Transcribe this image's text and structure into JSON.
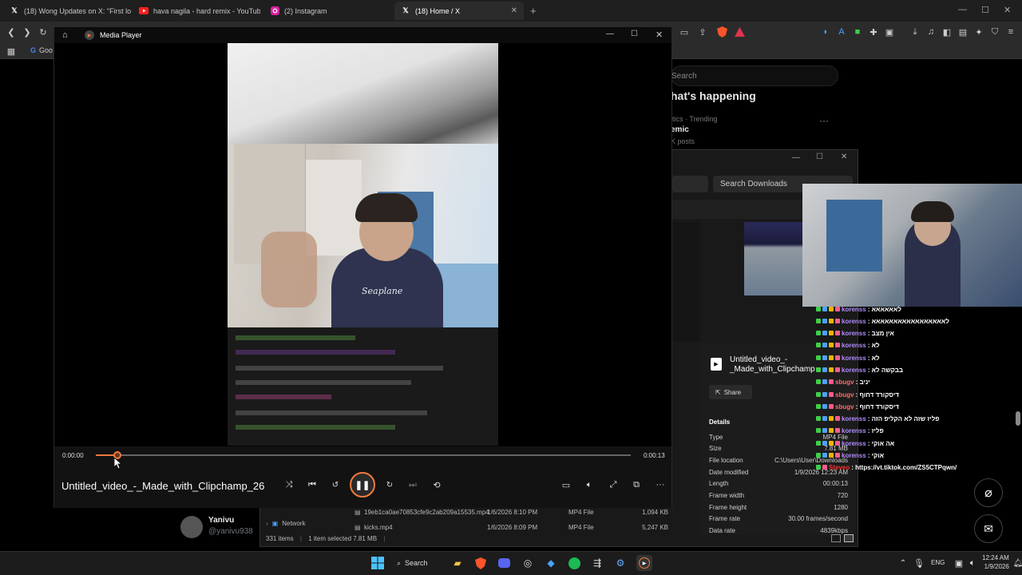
{
  "browser": {
    "tabs": [
      {
        "label": "(18) Wong Updates on X: \"First look",
        "icon": "x-logo"
      },
      {
        "label": "hava nagila - hard remix - YouTube",
        "icon": "youtube-logo"
      },
      {
        "label": "(2) Instagram",
        "icon": "instagram-logo"
      },
      {
        "label": "(18) Home / X",
        "icon": "x-logo"
      }
    ],
    "bookmark_label": "Goo"
  },
  "x_page": {
    "search_placeholder": "Search",
    "heading": "hat's happening",
    "trend_category": "itics · Trending",
    "trend_title": "emic",
    "trend_posts": "K posts"
  },
  "media_player": {
    "app_title": "Media Player",
    "current_time": "0:00:00",
    "total_time": "0:00:13",
    "progress": 0.04,
    "file_title": "Untitled_video_-_Made_with_Clipchamp_26"
  },
  "explorer": {
    "search_placeholder": "Search Downloads",
    "selected_file_name_line1": "Untitled_video_-",
    "selected_file_name_line2": "_Made_with_Clipchamp",
    "share_label": "Share",
    "details_heading": "Details",
    "details": [
      {
        "key": "Type",
        "value": "MP4 File"
      },
      {
        "key": "Size",
        "value": "7.81 MB"
      },
      {
        "key": "File location",
        "value": "C:\\Users\\User\\Downloads"
      },
      {
        "key": "Date modified",
        "value": "1/9/2026 12:23 AM"
      },
      {
        "key": "Length",
        "value": "00:00:13"
      },
      {
        "key": "Frame width",
        "value": "720"
      },
      {
        "key": "Frame height",
        "value": "1280"
      },
      {
        "key": "Frame rate",
        "value": "30.00 frames/second"
      },
      {
        "key": "Data rate",
        "value": "4839kbps"
      }
    ],
    "files": [
      {
        "name": "19eb1ca0ae70853cfe9c2ab209a15535.mp4",
        "date": "1/6/2026 8:10 PM",
        "type": "MP4 File",
        "size": "1,094 KB"
      },
      {
        "name": "kicks.mp4",
        "date": "1/6/2026 8:09 PM",
        "type": "MP4 File",
        "size": "5,247 KB"
      }
    ],
    "nav_network": "Network",
    "status_items": "331 items",
    "status_selected": "1 item selected  7.81 MB"
  },
  "chat": [
    {
      "user": "korenss",
      "msg": ": לאאאאאא"
    },
    {
      "user": "korenss",
      "msg": ": לאאאאאאאאאאאאאאאאא"
    },
    {
      "user": "korenss",
      "msg": ": אין מצב"
    },
    {
      "user": "korenss",
      "msg": ": לא"
    },
    {
      "user": "korenss",
      "msg": ": לא"
    },
    {
      "user": "korenss",
      "msg": ": בבקשה לא"
    },
    {
      "user": "sbugv",
      "msg": ": יניב"
    },
    {
      "user": "sbugv",
      "msg": ": דיסקורד דחוף"
    },
    {
      "user": "sbugv",
      "msg": ": דיסקורד דחוף"
    },
    {
      "user": "korenss",
      "msg": ": פליז שזה לא הקליפ הזה"
    },
    {
      "user": "korenss",
      "msg": ": פליז"
    },
    {
      "user": "korenss",
      "msg": ": אה אוקי"
    },
    {
      "user": "korenss",
      "msg": ": אוקי"
    },
    {
      "user": "Steveo",
      "msg": ": https://vt.tiktok.com/ZS5CTPqwn/"
    }
  ],
  "x_user": {
    "name": "Yanivu",
    "handle": "@yanivu938"
  },
  "taskbar": {
    "search_label": "Search",
    "language": "ENG",
    "time": "12:24 AM",
    "date": "1/9/2026"
  },
  "colors": {
    "accent": "#f47a3c",
    "chat_user": "#b18cff",
    "brave": "#fb542b"
  }
}
